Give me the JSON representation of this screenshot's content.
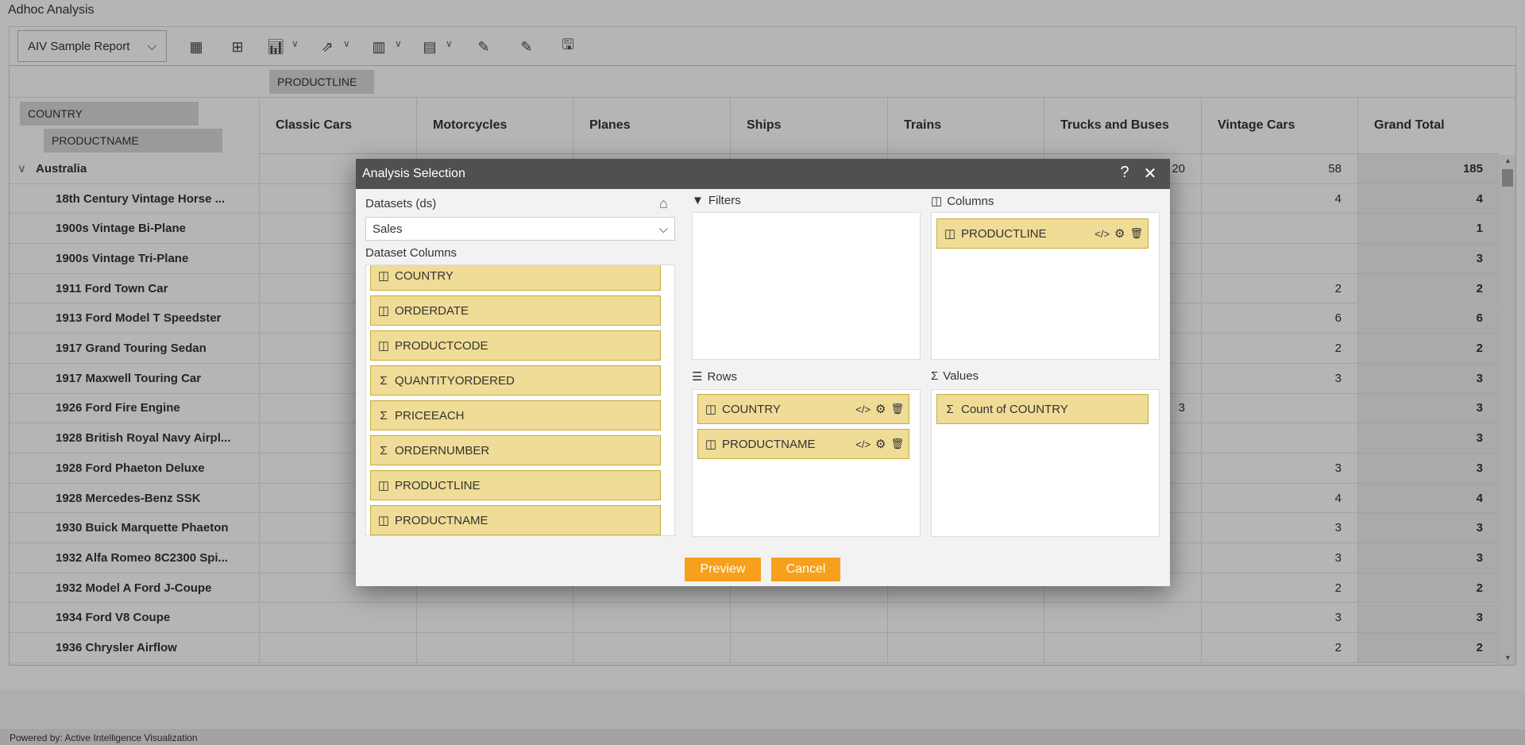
{
  "app": {
    "title": "Adhoc Analysis",
    "footer": "Powered by: Active Intelligence Visualization"
  },
  "toolbar": {
    "report": "AIV Sample Report",
    "icons": [
      "table-icon",
      "table-settings-icon",
      "chart-icon",
      "export-icon",
      "column-layout-icon",
      "row-layout-icon",
      "edit-code-icon",
      "edit-number-icon",
      "save-edit-icon"
    ]
  },
  "pivot": {
    "column_field": "PRODUCTLINE",
    "row_fields": [
      "COUNTRY",
      "PRODUCTNAME"
    ],
    "columns": [
      "Classic Cars",
      "Motorcycles",
      "Planes",
      "Ships",
      "Trains",
      "Trucks and Buses",
      "Vintage Cars",
      "Grand Total"
    ],
    "rows": [
      {
        "label": "Australia",
        "group": true,
        "values": [
          "",
          "",
          "",
          "",
          "",
          "20",
          "58",
          "185"
        ]
      },
      {
        "label": "18th Century Vintage Horse ...",
        "values": [
          "",
          "",
          "",
          "",
          "",
          "",
          "4",
          "4"
        ]
      },
      {
        "label": "1900s Vintage Bi-Plane",
        "values": [
          "",
          "",
          "",
          "",
          "",
          "",
          "",
          "1"
        ]
      },
      {
        "label": "1900s Vintage Tri-Plane",
        "values": [
          "",
          "",
          "",
          "",
          "",
          "",
          "",
          "3"
        ]
      },
      {
        "label": "1911 Ford Town Car",
        "values": [
          "",
          "",
          "",
          "",
          "",
          "",
          "2",
          "2"
        ]
      },
      {
        "label": "1913 Ford Model T Speedster",
        "values": [
          "",
          "",
          "",
          "",
          "",
          "",
          "6",
          "6"
        ]
      },
      {
        "label": "1917 Grand Touring Sedan",
        "values": [
          "",
          "",
          "",
          "",
          "",
          "",
          "2",
          "2"
        ]
      },
      {
        "label": "1917 Maxwell Touring Car",
        "values": [
          "",
          "",
          "",
          "",
          "",
          "",
          "3",
          "3"
        ]
      },
      {
        "label": "1926 Ford Fire Engine",
        "values": [
          "",
          "",
          "",
          "",
          "",
          "3",
          "",
          "3"
        ]
      },
      {
        "label": "1928 British Royal Navy Airpl...",
        "values": [
          "",
          "",
          "",
          "",
          "",
          "",
          "",
          "3"
        ]
      },
      {
        "label": "1928 Ford Phaeton Deluxe",
        "values": [
          "",
          "",
          "",
          "",
          "",
          "",
          "3",
          "3"
        ]
      },
      {
        "label": "1928 Mercedes-Benz SSK",
        "values": [
          "",
          "",
          "",
          "",
          "",
          "",
          "4",
          "4"
        ]
      },
      {
        "label": "1930 Buick Marquette Phaeton",
        "values": [
          "",
          "",
          "",
          "",
          "",
          "",
          "3",
          "3"
        ]
      },
      {
        "label": "1932 Alfa Romeo 8C2300 Spi...",
        "values": [
          "",
          "",
          "",
          "",
          "",
          "",
          "3",
          "3"
        ]
      },
      {
        "label": "1932 Model A Ford J-Coupe",
        "values": [
          "",
          "",
          "",
          "",
          "",
          "",
          "2",
          "2"
        ]
      },
      {
        "label": "1934 Ford V8 Coupe",
        "values": [
          "",
          "",
          "",
          "",
          "",
          "",
          "3",
          "3"
        ]
      },
      {
        "label": "1936 Chrysler Airflow",
        "values": [
          "",
          "",
          "",
          "",
          "",
          "",
          "2",
          "2"
        ]
      }
    ]
  },
  "dialog": {
    "title": "Analysis Selection",
    "help": "?",
    "close": "✕",
    "datasets_label": "Datasets (ds)",
    "dataset": "Sales",
    "dataset_columns_label": "Dataset Columns",
    "dataset_columns": [
      {
        "name": "COUNTRY",
        "type": "dimension"
      },
      {
        "name": "ORDERDATE",
        "type": "dimension"
      },
      {
        "name": "PRODUCTCODE",
        "type": "dimension"
      },
      {
        "name": "QUANTITYORDERED",
        "type": "measure"
      },
      {
        "name": "PRICEEACH",
        "type": "measure"
      },
      {
        "name": "ORDERNUMBER",
        "type": "measure"
      },
      {
        "name": "PRODUCTLINE",
        "type": "dimension"
      },
      {
        "name": "PRODUCTNAME",
        "type": "dimension"
      }
    ],
    "filters_label": "Filters",
    "columns_label": "Columns",
    "rows_label": "Rows",
    "values_label": "Values",
    "columns": [
      "PRODUCTLINE"
    ],
    "rows": [
      "COUNTRY",
      "PRODUCTNAME"
    ],
    "values": [
      "Count of COUNTRY"
    ],
    "preview": "Preview",
    "cancel": "Cancel",
    "colors": {
      "accent": "#f7a01c",
      "chip": "#efdc96",
      "titlebar": "#505050"
    }
  }
}
